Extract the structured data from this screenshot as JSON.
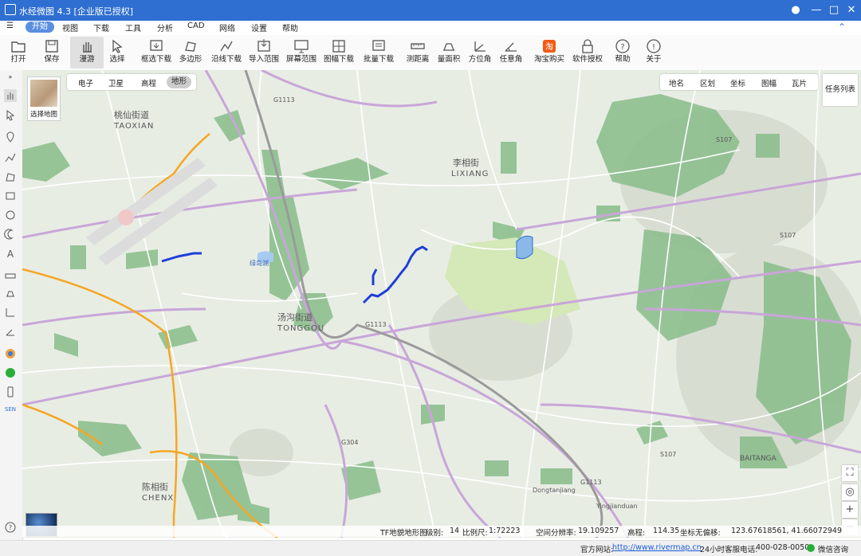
{
  "app": {
    "title": "水经微图 4.3 [企业版已授权]"
  },
  "menu": [
    "开始",
    "视图",
    "下载",
    "工具",
    "分析",
    "CAD",
    "网络",
    "设置",
    "帮助"
  ],
  "toolbar": [
    "打开",
    "保存",
    "漫游",
    "选择",
    "框选下载",
    "多边形",
    "沿线下载",
    "导入范围",
    "屏幕范围",
    "图幅下载",
    "批量下载",
    "测距离",
    "量面积",
    "方位角",
    "任意角",
    "淘宝购买",
    "软件授权",
    "帮助",
    "关于"
  ],
  "map": {
    "select_map": "选择地图",
    "layer_tabs": [
      "电子",
      "卫星",
      "高程",
      "地形"
    ],
    "active_layer": "地形",
    "right_tabs": [
      "地名",
      "区划",
      "坐标",
      "图幅",
      "瓦片"
    ],
    "task_list": "任务列表",
    "labels": {
      "taoxian_cn": "桃仙街道",
      "taoxian_en": "TAOXIAN",
      "lixiang_cn": "李相街",
      "lixiang_en": "LIXIANG",
      "tonggou_cn": "汤沟街道",
      "tonggou_en": "TONGGOU",
      "reservoir": "绿岛湖",
      "chenxiang_cn": "陈相街",
      "chenxiang_en": "CHENX",
      "dongtan": "Dongtanjiang",
      "baita": "BAITANGA",
      "yingjian": "Yingjianduan",
      "g1113": "G1113",
      "g1113b": "G1113",
      "g304": "G304",
      "s107": "S107",
      "s107b": "S107",
      "s107c": "S107",
      "g1113c": "G1113"
    }
  },
  "status": {
    "source": "TF地貌地形图",
    "level_label": "级别:",
    "level": "14",
    "scale_label": "比例尺:",
    "scale": "1:72223",
    "resolution_label": "空间分辨率:",
    "resolution": "19.109257",
    "elev_label": "高程:",
    "elev": "114.35",
    "coord_label": "坐标无偏移:",
    "coord": "123.67618561, 41.66072949"
  },
  "footer": {
    "site_label": "官方网站:",
    "site": "http://www.rivermap.cn",
    "hotline_label": "24小时客服电话:",
    "hotline": "400-028-0050",
    "wechat": "微信咨询"
  },
  "colors": {
    "title_bar": "#2f6fd1",
    "route": "#1e3fd8",
    "road_major": "#f5a623",
    "park": "#8dbf8e"
  }
}
